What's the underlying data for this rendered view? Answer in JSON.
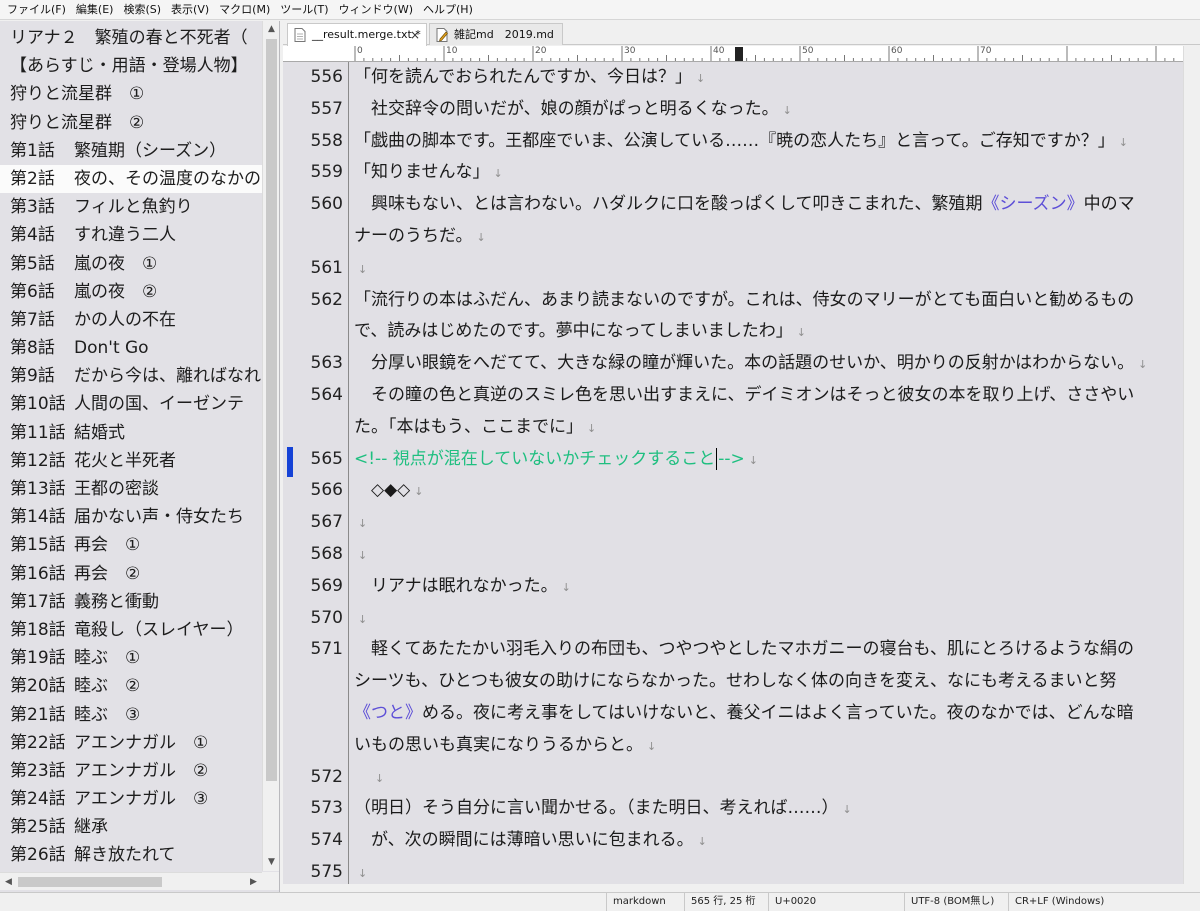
{
  "menubar": {
    "items": [
      "ファイル(F)",
      "編集(E)",
      "検索(S)",
      "表示(V)",
      "マクロ(M)",
      "ツール(T)",
      "ウィンドウ(W)",
      "ヘルプ(H)"
    ]
  },
  "outline": {
    "items": [
      {
        "num": "",
        "title": "リアナ２　繁殖の春と不死者（"
      },
      {
        "num": "",
        "title": "【あらすじ・用語・登場人物】"
      },
      {
        "num": "",
        "title": "狩りと流星群　①"
      },
      {
        "num": "",
        "title": "狩りと流星群　②"
      },
      {
        "num": "第1話",
        "title": "繁殖期（シーズン）"
      },
      {
        "num": "第2話",
        "title": "夜の、その温度のなかの"
      },
      {
        "num": "第3話",
        "title": "フィルと魚釣り"
      },
      {
        "num": "第4話",
        "title": "すれ違う二人"
      },
      {
        "num": "第5話",
        "title": "嵐の夜　①"
      },
      {
        "num": "第6話",
        "title": "嵐の夜　②"
      },
      {
        "num": "第7話",
        "title": "かの人の不在"
      },
      {
        "num": "第8話",
        "title": "Don't Go"
      },
      {
        "num": "第9話",
        "title": "だから今は、離ればなれ"
      },
      {
        "num": "第10話",
        "title": "人間の国、イーゼンテ"
      },
      {
        "num": "第11話",
        "title": "結婚式"
      },
      {
        "num": "第12話",
        "title": "花火と半死者"
      },
      {
        "num": "第13話",
        "title": "王都の密談"
      },
      {
        "num": "第14話",
        "title": "届かない声・侍女たち"
      },
      {
        "num": "第15話",
        "title": "再会　①"
      },
      {
        "num": "第16話",
        "title": "再会　②"
      },
      {
        "num": "第17話",
        "title": "義務と衝動"
      },
      {
        "num": "第18話",
        "title": "竜殺し（スレイヤー）"
      },
      {
        "num": "第19話",
        "title": "睦ぶ　①"
      },
      {
        "num": "第20話",
        "title": "睦ぶ　②"
      },
      {
        "num": "第21話",
        "title": "睦ぶ　③"
      },
      {
        "num": "第22話",
        "title": "アエンナガル　①"
      },
      {
        "num": "第23話",
        "title": "アエンナガル　②"
      },
      {
        "num": "第24話",
        "title": "アエンナガル　③"
      },
      {
        "num": "第25話",
        "title": "継承"
      },
      {
        "num": "第26話",
        "title": "解き放たれて"
      }
    ],
    "selected_index": 5
  },
  "tabs": [
    {
      "label": "__result.merge.txt *",
      "close": "×"
    },
    {
      "label": "雑記md　2019.md"
    }
  ],
  "ruler": {
    "labels": [
      "0",
      "10",
      "20",
      "30",
      "40",
      "50",
      "60",
      "70"
    ]
  },
  "editor": {
    "eol_mark": "↓",
    "lines": [
      {
        "no": "556",
        "segs": [
          {
            "t": "「何を読んでおられたんですか、今日は？」"
          }
        ],
        "eol": true
      },
      {
        "no": "557",
        "segs": [
          {
            "t": "　社交辞令の問いだが、娘の顔がぱっと明るくなった。"
          }
        ],
        "eol": true
      },
      {
        "no": "558",
        "segs": [
          {
            "t": "「戯曲の脚本です。王都座でいま、公演している……『暁の恋人たち』と言って。ご存知ですか？」"
          }
        ],
        "eol": true
      },
      {
        "no": "559",
        "segs": [
          {
            "t": "「知りませんな」"
          }
        ],
        "eol": true
      },
      {
        "no": "560",
        "segs": [
          {
            "t": "　興味もない、とは言わない。ハダルクに口を酸っぱくして叩きこまれた、繁殖期"
          },
          {
            "t": "《シーズン》",
            "ruby": true
          },
          {
            "t": "中のマ"
          }
        ],
        "eol": false
      },
      {
        "no": "",
        "segs": [
          {
            "t": "ナーのうちだ。"
          }
        ],
        "eol": true
      },
      {
        "no": "561",
        "segs": [],
        "eol": true
      },
      {
        "no": "562",
        "segs": [
          {
            "t": "「流行りの本はふだん、あまり読まないのですが。これは、侍女のマリーがとても面白いと勧めるもの"
          }
        ],
        "eol": false
      },
      {
        "no": "",
        "segs": [
          {
            "t": "で、読みはじめたのです。夢中になってしまいましたわ」"
          }
        ],
        "eol": true
      },
      {
        "no": "563",
        "segs": [
          {
            "t": "　分厚い眼鏡をへだてて、大きな緑の瞳が輝いた。本の話題のせいか、明かりの反射かはわからない。"
          }
        ],
        "eol": true
      },
      {
        "no": "564",
        "segs": [
          {
            "t": "　その瞳の色と真逆のスミレ色を思い出すまえに、デイミオンはそっと彼女の本を取り上げ、ささやい"
          }
        ],
        "eol": false
      },
      {
        "no": "",
        "segs": [
          {
            "t": "た。「本はもう、ここまでに」"
          }
        ],
        "eol": true
      },
      {
        "no": "565",
        "segs": [
          {
            "t": "<!-- 視点が混在していないかチェックすること",
            "cmt": true
          },
          {
            "caret": true
          },
          {
            "t": "-->",
            "cmt": true
          }
        ],
        "eol": true
      },
      {
        "no": "566",
        "segs": [
          {
            "t": "　◇◆◇"
          }
        ],
        "eol": true
      },
      {
        "no": "567",
        "segs": [],
        "eol": true
      },
      {
        "no": "568",
        "segs": [],
        "eol": true
      },
      {
        "no": "569",
        "segs": [
          {
            "t": "　リアナは眠れなかった。"
          }
        ],
        "eol": true
      },
      {
        "no": "570",
        "segs": [],
        "eol": true
      },
      {
        "no": "571",
        "segs": [
          {
            "t": "　軽くてあたたかい羽毛入りの布団も、つやつやとしたマホガニーの寝台も、肌にとろけるような絹の"
          }
        ],
        "eol": false
      },
      {
        "no": "",
        "segs": [
          {
            "t": "シーツも、ひとつも彼女の助けにならなかった。せわしなく体の向きを変え、なにも考えるまいと努"
          }
        ],
        "eol": false
      },
      {
        "no": "",
        "segs": [
          {
            "t": "《つと》",
            "ruby": true
          },
          {
            "t": "める。夜に考え事をしてはいけないと、養父イニはよく言っていた。夜のなかでは、どんな暗"
          }
        ],
        "eol": false
      },
      {
        "no": "",
        "segs": [
          {
            "t": "いもの思いも真実になりうるからと。"
          }
        ],
        "eol": true
      },
      {
        "no": "572",
        "segs": [
          {
            "t": "　"
          }
        ],
        "eol": true
      },
      {
        "no": "573",
        "segs": [
          {
            "t": "（明日）そう自分に言い聞かせる。（また明日、考えれば……）"
          }
        ],
        "eol": true
      },
      {
        "no": "574",
        "segs": [
          {
            "t": "　が、次の瞬間には薄暗い思いに包まれる。"
          }
        ],
        "eol": true
      },
      {
        "no": "575",
        "segs": [],
        "eol": true
      }
    ]
  },
  "statusbar": {
    "mode": "markdown",
    "position": "565 行, 25 桁",
    "char_code": "U+0020",
    "encoding": "UTF-8 (BOM無し)",
    "newline": "CR+LF (Windows)"
  },
  "colors": {
    "editor_bg": "#e1e0e5",
    "comment": "#1fbf80",
    "ruby": "#5d4fd7",
    "current_line_marker": "#1542d6"
  }
}
